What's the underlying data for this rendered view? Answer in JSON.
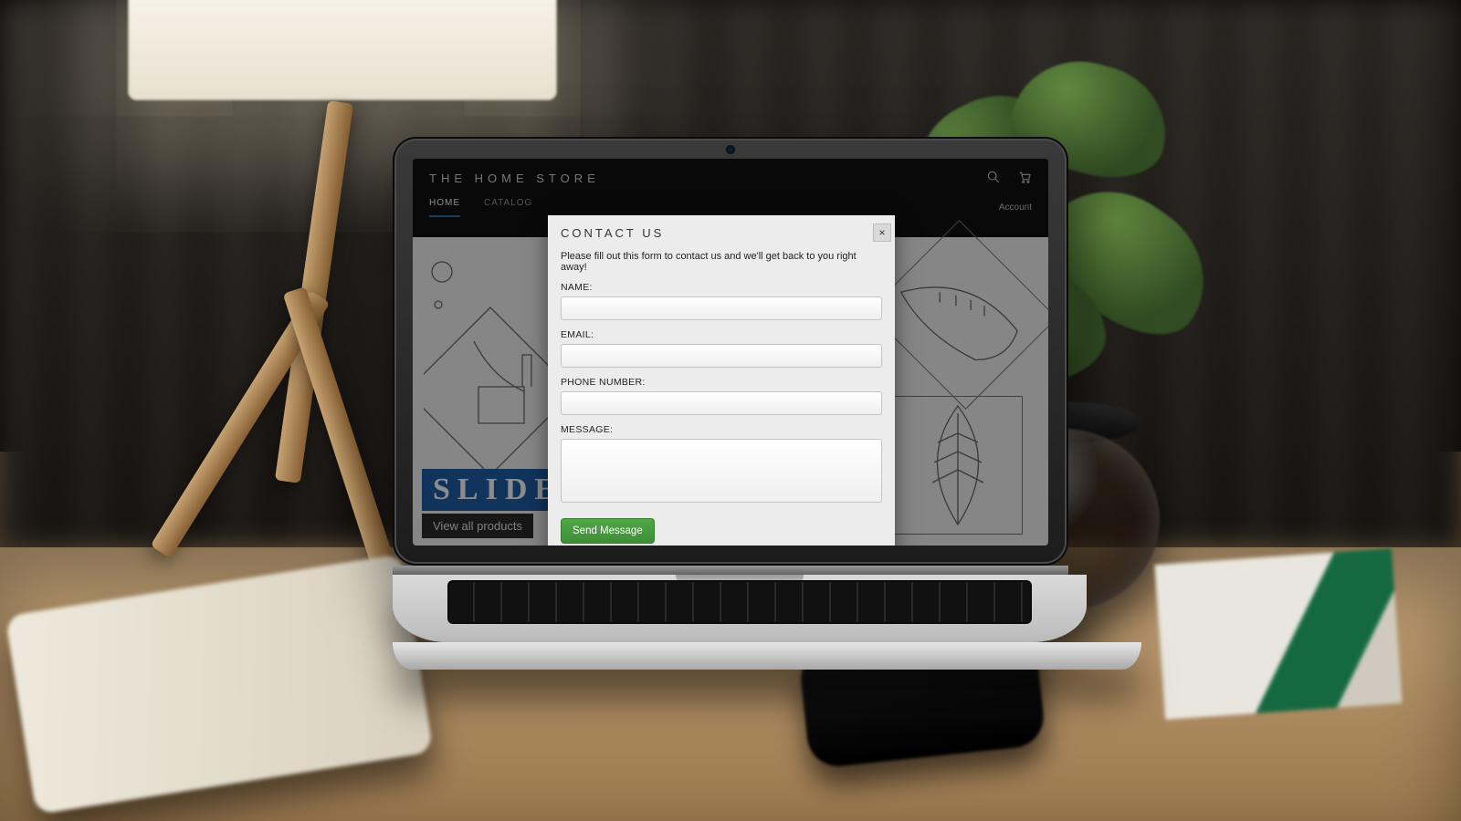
{
  "site": {
    "brand": "THE HOME STORE",
    "nav": {
      "home": "HOME",
      "catalog": "CATALOG"
    },
    "account_label": "Account",
    "slide_badge": "SLIDE",
    "view_all": "View all products"
  },
  "modal": {
    "title": "CONTACT US",
    "close": "×",
    "intro": "Please fill out this form to contact us and we'll get back to you right away!",
    "labels": {
      "name": "NAME:",
      "email": "EMAIL:",
      "phone": "PHONE NUMBER:",
      "message": "MESSAGE:"
    },
    "values": {
      "name": "",
      "email": "",
      "phone": "",
      "message": ""
    },
    "submit": "Send Message"
  },
  "colors": {
    "accent_blue": "#1f5fa8",
    "submit_green": "#3f8e38"
  }
}
